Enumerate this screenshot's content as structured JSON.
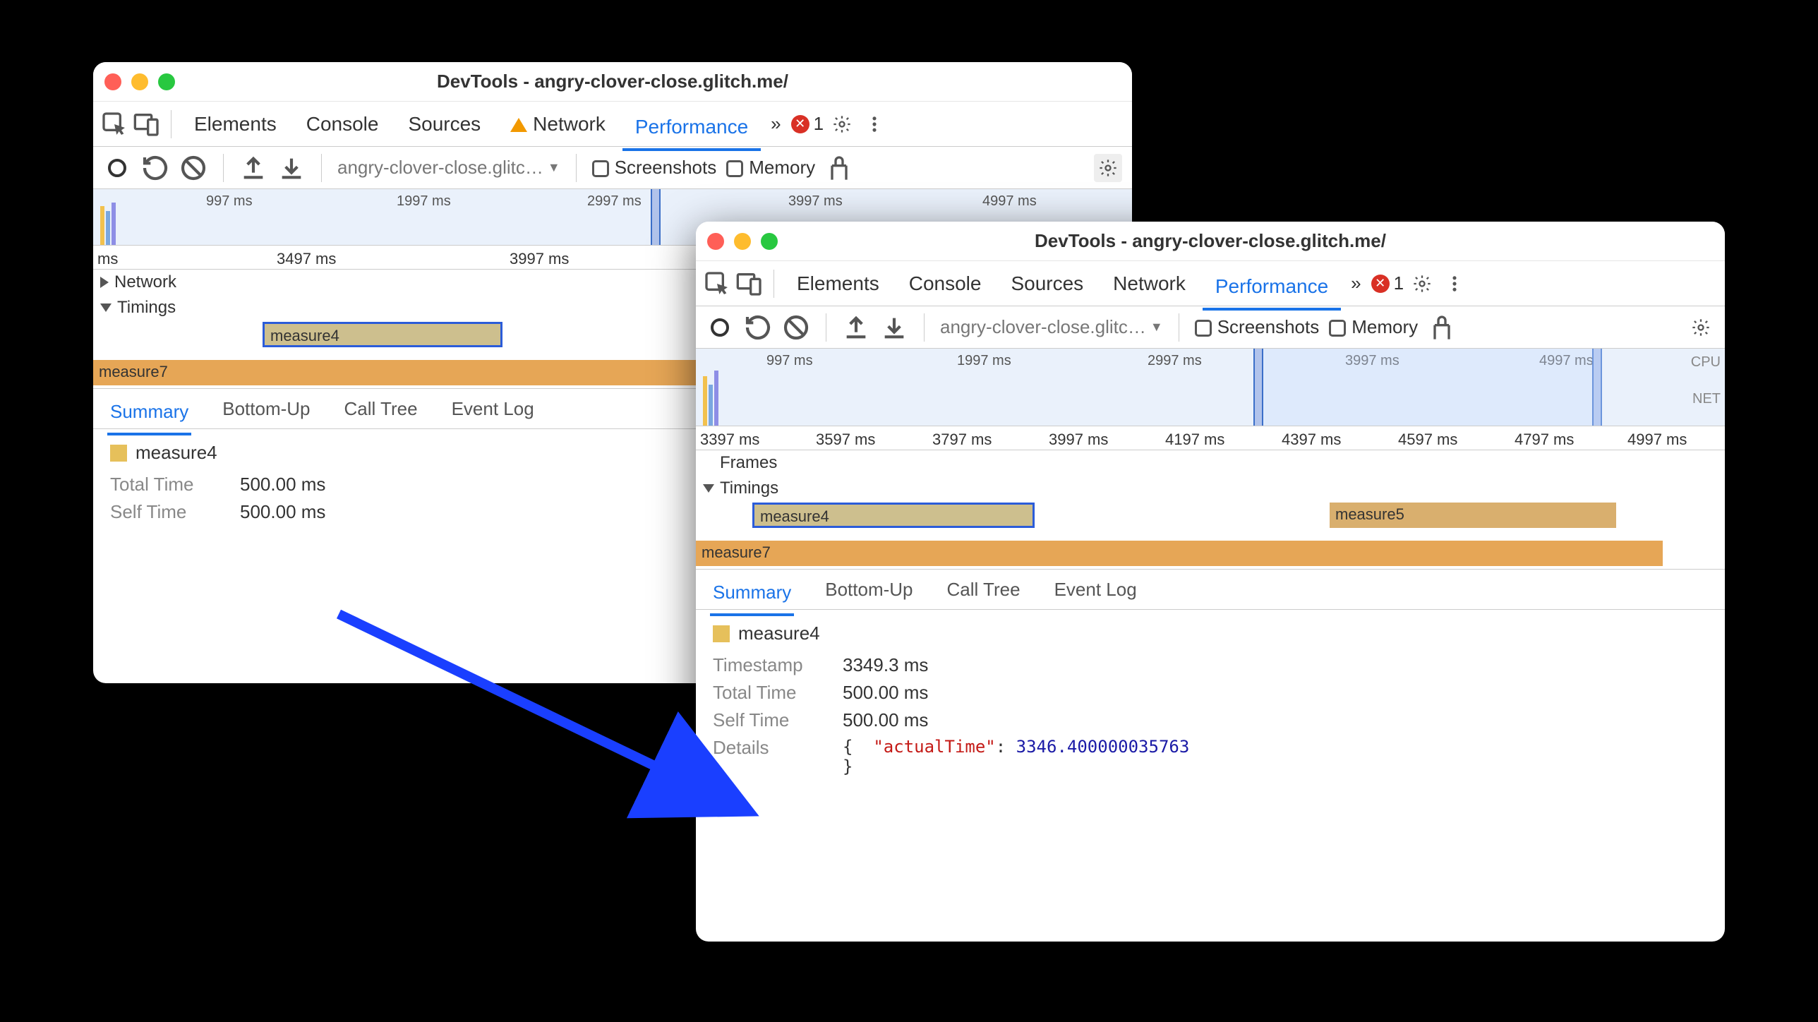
{
  "win1": {
    "title": "DevTools - angry-clover-close.glitch.me/",
    "tabs": {
      "elements": "Elements",
      "console": "Console",
      "sources": "Sources",
      "network": "Network",
      "performance": "Performance",
      "more": "»",
      "err_count": "1"
    },
    "toolbar": {
      "url": "angry-clover-close.glitc…",
      "screenshots": "Screenshots",
      "memory": "Memory"
    },
    "mini_ticks": [
      "997 ms",
      "1997 ms",
      "2997 ms",
      "3997 ms",
      "4997 ms"
    ],
    "ruler_start": "ms",
    "ruler": [
      "3497 ms",
      "3997 ms"
    ],
    "track_network": "Network",
    "track_timings": "Timings",
    "bar_measure4": "measure4",
    "bar_measure7": "measure7",
    "dtabs": {
      "summary": "Summary",
      "bottomup": "Bottom-Up",
      "calltree": "Call Tree",
      "eventlog": "Event Log"
    },
    "detail_name": "measure4",
    "rows": {
      "total_k": "Total Time",
      "total_v": "500.00 ms",
      "self_k": "Self Time",
      "self_v": "500.00 ms"
    }
  },
  "win2": {
    "title": "DevTools - angry-clover-close.glitch.me/",
    "tabs": {
      "elements": "Elements",
      "console": "Console",
      "sources": "Sources",
      "network": "Network",
      "performance": "Performance",
      "more": "»",
      "err_count": "1"
    },
    "toolbar": {
      "url": "angry-clover-close.glitc…",
      "screenshots": "Screenshots",
      "memory": "Memory"
    },
    "mini_ticks": [
      "997 ms",
      "1997 ms",
      "2997 ms",
      "3997 ms",
      "4997 ms"
    ],
    "mini_side": {
      "cpu": "CPU",
      "net": "NET"
    },
    "ruler": [
      "3397 ms",
      "3597 ms",
      "3797 ms",
      "3997 ms",
      "4197 ms",
      "4397 ms",
      "4597 ms",
      "4797 ms",
      "4997 ms"
    ],
    "track_frames": "Frames",
    "track_timings": "Timings",
    "bar_measure4": "measure4",
    "bar_measure5": "measure5",
    "bar_measure7": "measure7",
    "dtabs": {
      "summary": "Summary",
      "bottomup": "Bottom-Up",
      "calltree": "Call Tree",
      "eventlog": "Event Log"
    },
    "detail_name": "measure4",
    "rows": {
      "ts_k": "Timestamp",
      "ts_v": "3349.3 ms",
      "total_k": "Total Time",
      "total_v": "500.00 ms",
      "self_k": "Self Time",
      "self_v": "500.00 ms",
      "det_k": "Details",
      "det_key": "\"actualTime\"",
      "det_val": "3346.400000035763"
    }
  }
}
